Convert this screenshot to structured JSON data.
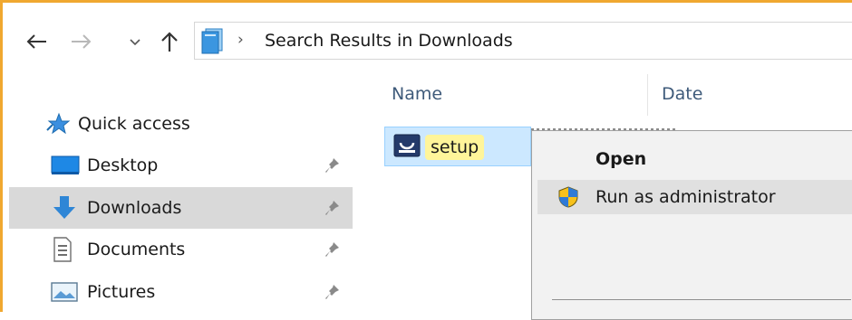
{
  "address": {
    "separator": "›",
    "path": "Search Results in Downloads"
  },
  "nav": {
    "back_icon": "back-arrow-icon",
    "forward_icon": "forward-arrow-icon",
    "recent_icon": "chevron-down-icon",
    "up_icon": "up-arrow-icon"
  },
  "columns": {
    "name": "Name",
    "date": "Date"
  },
  "sidebar": {
    "quick_access": "Quick access",
    "items": [
      {
        "label": "Desktop",
        "icon": "desktop-icon",
        "pinned": true
      },
      {
        "label": "Downloads",
        "icon": "downloads-icon",
        "pinned": true,
        "selected": true
      },
      {
        "label": "Documents",
        "icon": "documents-icon",
        "pinned": true
      },
      {
        "label": "Pictures",
        "icon": "pictures-icon",
        "pinned": true
      }
    ]
  },
  "file": {
    "name": "setup",
    "icon": "setup-app-icon"
  },
  "context_menu": {
    "items": [
      {
        "label": "Open",
        "bold": true
      },
      {
        "label": "Run as administrator",
        "icon": "uac-shield-icon",
        "hovered": true
      }
    ]
  },
  "colors": {
    "accent_border": "#f0a830",
    "selection": "#cce8ff",
    "highlight": "#fff59a",
    "header_text": "#3e5a7a"
  }
}
